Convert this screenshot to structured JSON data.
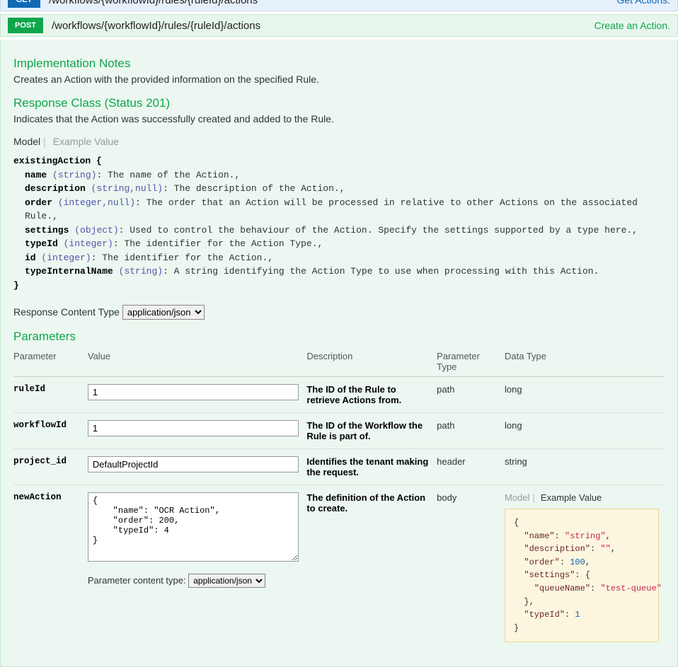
{
  "endpoint_get": {
    "method": "GET",
    "path": "/workflows/{workflowId}/rules/{ruleId}/actions",
    "summary": "Get Actions."
  },
  "endpoint_post": {
    "method": "POST",
    "path": "/workflows/{workflowId}/rules/{ruleId}/actions",
    "summary": "Create an Action."
  },
  "impl_notes": {
    "heading": "Implementation Notes",
    "text": "Creates an Action with the provided information on the specified Rule."
  },
  "response_class": {
    "heading": "Response Class (Status 201)",
    "text": "Indicates that the Action was successfully created and added to the Rule."
  },
  "model_toggle": {
    "model": "Model",
    "example": "Example Value"
  },
  "schema": {
    "type_name": "existingAction {",
    "close": "}",
    "props": [
      {
        "name": "name",
        "type": "(string)",
        "desc": ": The name of the Action.,"
      },
      {
        "name": "description",
        "type": "(string,null)",
        "desc": ": The description of the Action.,"
      },
      {
        "name": "order",
        "type": "(integer,null)",
        "desc": ": The order that an Action will be processed in relative to other Actions on the associated Rule.,"
      },
      {
        "name": "settings",
        "type": "(object)",
        "desc": ": Used to control the behaviour of the Action. Specify the settings supported by a type here.,"
      },
      {
        "name": "typeId",
        "type": "(integer)",
        "desc": ": The identifier for the Action Type.,"
      },
      {
        "name": "id",
        "type": "(integer)",
        "desc": ": The identifier for the Action.,"
      },
      {
        "name": "typeInternalName",
        "type": "(string)",
        "desc": ": A string identifying the Action Type to use when processing with this Action."
      }
    ]
  },
  "response_content_type": {
    "label": "Response Content Type",
    "value": "application/json"
  },
  "parameters_heading": "Parameters",
  "param_headers": {
    "parameter": "Parameter",
    "value": "Value",
    "description": "Description",
    "ptype": "Parameter Type",
    "dtype": "Data Type"
  },
  "params": {
    "ruleId": {
      "name": "ruleId",
      "value": "1",
      "desc": "The ID of the Rule to retrieve Actions from.",
      "ptype": "path",
      "dtype": "long"
    },
    "workflowId": {
      "name": "workflowId",
      "value": "1",
      "desc": "The ID of the Workflow the Rule is part of.",
      "ptype": "path",
      "dtype": "long"
    },
    "project_id": {
      "name": "project_id",
      "value": "DefaultProjectId",
      "desc": "Identifies the tenant making the request.",
      "ptype": "header",
      "dtype": "string"
    },
    "newAction": {
      "name": "newAction",
      "value": "{\n    \"name\": \"OCR Action\",\n    \"order\": 200,\n    \"typeId\": 4\n}",
      "desc": "The definition of the Action to create.",
      "ptype": "body"
    }
  },
  "param_content_type": {
    "label": "Parameter content type:",
    "value": "application/json"
  },
  "dt_model_toggle": {
    "model": "Model",
    "example": "Example Value"
  },
  "example_value": {
    "name_key": "\"name\"",
    "name_val": "\"string\"",
    "desc_key": "\"description\"",
    "desc_val": "\"\"",
    "order_key": "\"order\"",
    "order_val": "100",
    "settings_key": "\"settings\"",
    "queue_key": "\"queueName\"",
    "queue_val": "\"test-queue\"",
    "typeid_key": "\"typeId\"",
    "typeid_val": "1"
  }
}
